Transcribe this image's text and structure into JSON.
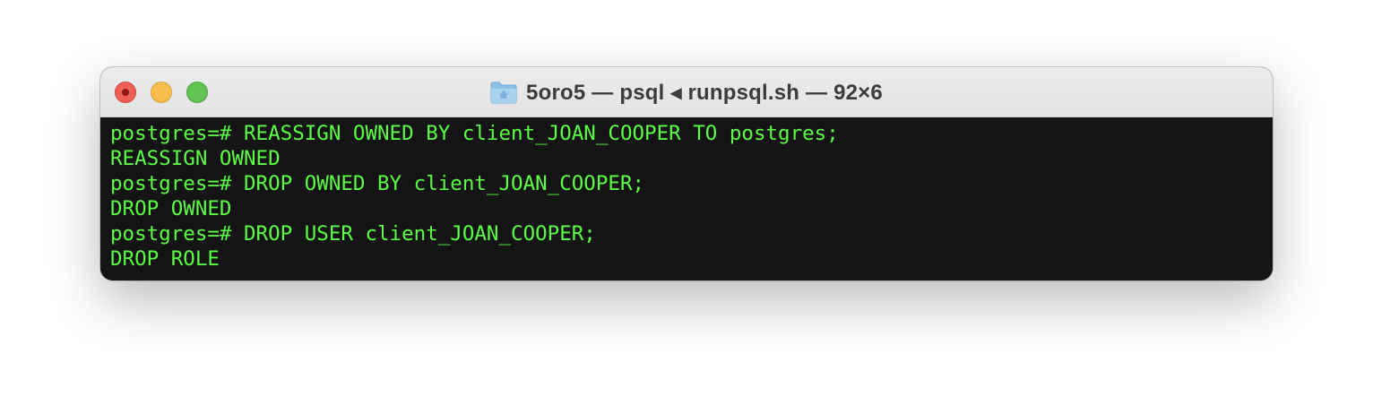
{
  "window": {
    "title": "5oro5 — psql ◂ runpsql.sh — 92×6",
    "icon": "folder-home-icon"
  },
  "colors": {
    "terminal_bg": "#141414",
    "terminal_text": "#5dfc47",
    "close": "#ee5f57",
    "minimize": "#f6be4f",
    "zoom": "#61c454"
  },
  "terminal": {
    "lines": [
      "postgres=# REASSIGN OWNED BY client_JOAN_COOPER TO postgres;",
      "REASSIGN OWNED",
      "postgres=# DROP OWNED BY client_JOAN_COOPER;",
      "DROP OWNED",
      "postgres=# DROP USER client_JOAN_COOPER;",
      "DROP ROLE"
    ]
  }
}
